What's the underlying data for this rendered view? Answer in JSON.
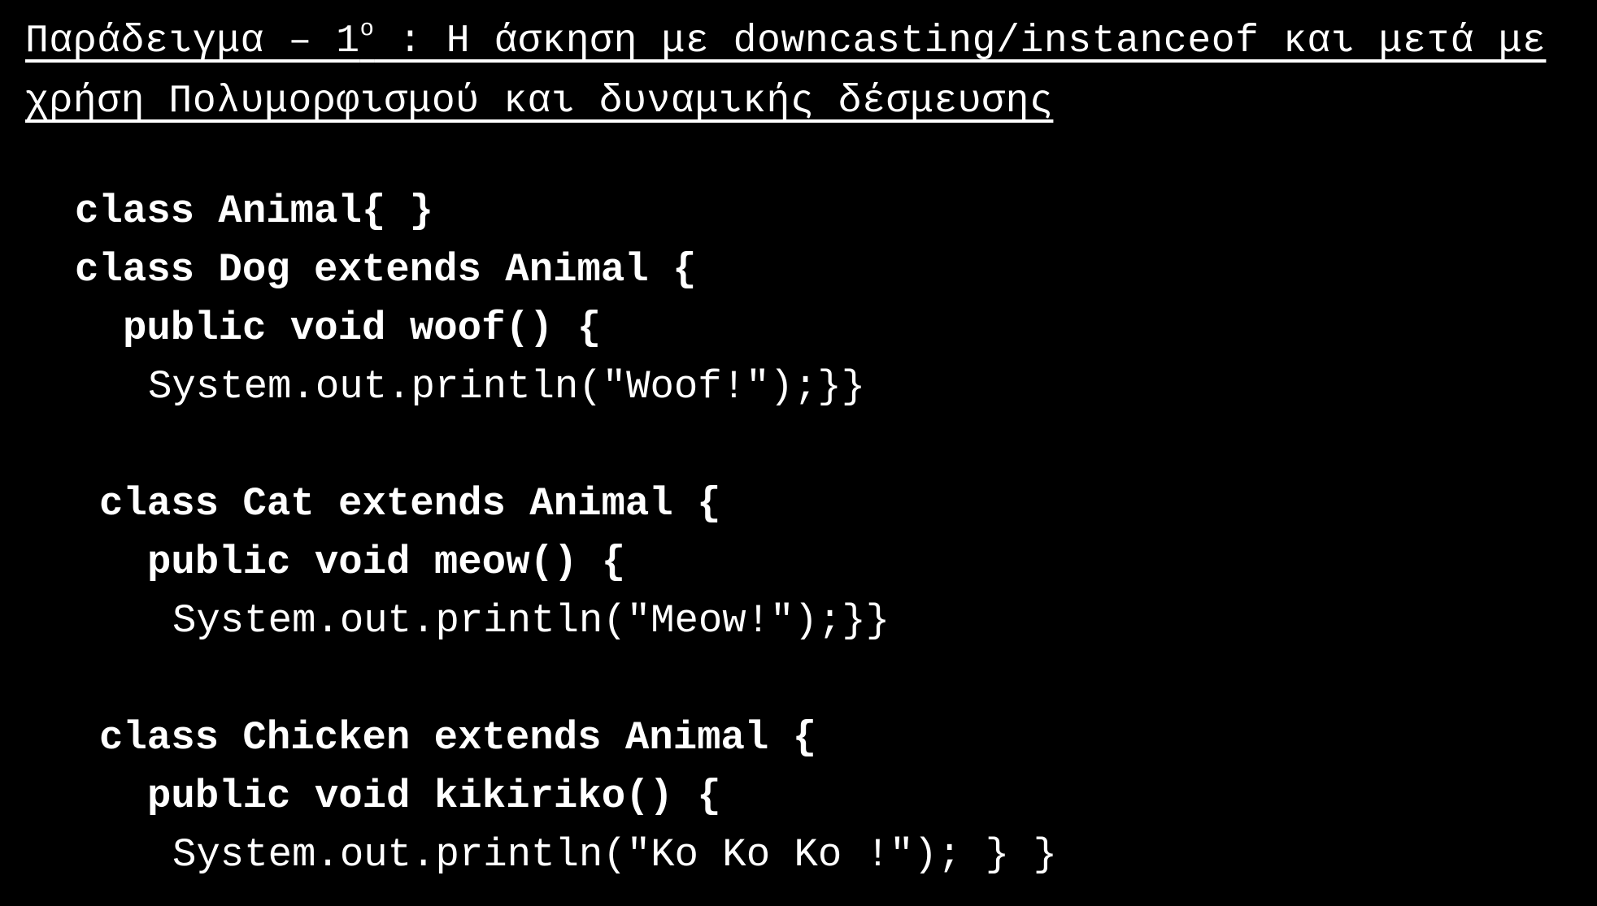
{
  "slide": {
    "title": {
      "line1_prefix": "Παράδειγμα – 1",
      "line1_superscript": "ο",
      "line1_suffix": " : Η άσκηση με downcasting/instanceof και μετά με",
      "line2": "χρήση Πολυμορφισμού και δυναμικής δέσμευσης"
    },
    "code": {
      "animal_class": "class Animal{ }",
      "dog_class": "class Dog extends Animal {",
      "dog_method": "public void woof() {",
      "dog_print": "System.out.println(\"Woof!\");}}",
      "cat_class": "class Cat extends Animal {",
      "cat_method": "public void meow() {",
      "cat_print": "System.out.println(\"Meow!\");}}",
      "chicken_class": "class Chicken extends Animal {",
      "chicken_method": "public void kikiriko() {",
      "chicken_print": "System.out.println(\"Ko Ko Ko !\"); } }"
    },
    "colors": {
      "background": "#000000",
      "text": "#ffffff"
    }
  }
}
